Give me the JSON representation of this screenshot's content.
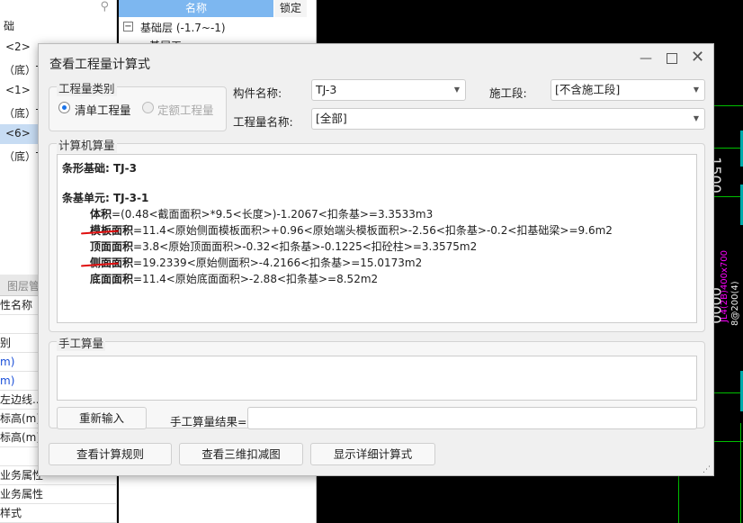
{
  "left_tree": {
    "items": [
      "础",
      "<2>",
      "（底）T.",
      "<1>",
      "（底）T.",
      "<6>",
      "（底）T."
    ]
  },
  "left_props": {
    "tab": "图层管",
    "rows": [
      "性名称",
      "",
      "别",
      "m)",
      "m)",
      "左边线...",
      "标高(m)",
      "标高(m)",
      "",
      "业务属性",
      "业务属性",
      "样式"
    ]
  },
  "mid_panel": {
    "col_name": "名称",
    "col_lock": "锁定",
    "floor": "基础层 (-1.7~-1)",
    "sub": "基层工"
  },
  "dialog": {
    "title": "查看工程量计算式",
    "category": {
      "label": "工程量类别",
      "opt1": "清单工程量",
      "opt2": "定额工程量",
      "selected": "清单工程量"
    },
    "component_label": "构件名称:",
    "component_value": "TJ-3",
    "stage_label": "施工段:",
    "stage_value": "[不含施工段]",
    "qty_label": "工程量名称:",
    "qty_value": "[全部]",
    "computer": {
      "label": "计算机算量",
      "title": "条形基础: TJ-3",
      "unit": "条基单元: TJ-3-1",
      "lines": [
        {
          "name": "体积",
          "expr": "=(0.48<截面面积>*9.5<长度>)-1.2067<扣条基>=3.3533m3"
        },
        {
          "name": "模板面积",
          "expr": "=11.4<原始侧面模板面积>+0.96<原始端头模板面积>-2.56<扣条基>-0.2<扣基础梁>=9.6m2"
        },
        {
          "name": "顶面面积",
          "expr": "=3.8<原始顶面面积>-0.32<扣条基>-0.1225<扣砼柱>=3.3575m2"
        },
        {
          "name": "侧面面积",
          "expr": "=19.2339<原始侧面积>-4.2166<扣条基>=15.0173m2"
        },
        {
          "name": "底面面积",
          "expr": "=11.4<原始底面面积>-2.88<扣条基>=8.52m2"
        }
      ]
    },
    "manual": {
      "label": "手工算量",
      "reenter": "重新输入",
      "result_label": "手工算量结果=",
      "result_value": ""
    },
    "buttons": {
      "rules": "查看计算规则",
      "view3d": "查看三维扣减图",
      "detail": "显示详细计算式"
    }
  },
  "cad": {
    "text1": "1500",
    "text2": "JL4(2B)400x700",
    "text3": "8@200(4)",
    "text4": "0000"
  },
  "colors": {
    "header_blue": "#7db7f0",
    "cad_green": "#00c000",
    "cad_magenta": "#ff00ff",
    "underline_red": "#e01010"
  }
}
